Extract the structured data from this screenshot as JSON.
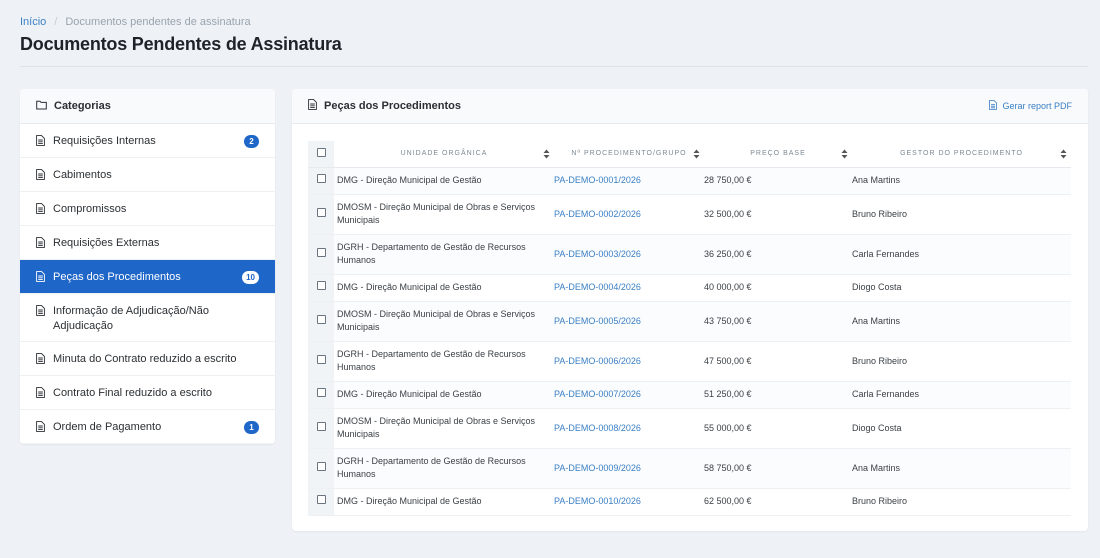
{
  "breadcrumb": {
    "home": "Início",
    "current": "Documentos pendentes de assinatura"
  },
  "page_title": "Documentos Pendentes de Assinatura",
  "sidebar": {
    "title": "Categorias",
    "items": [
      {
        "label": "Requisições Internas",
        "badge": "2"
      },
      {
        "label": "Cabimentos",
        "badge": ""
      },
      {
        "label": "Compromissos",
        "badge": ""
      },
      {
        "label": "Requisições Externas",
        "badge": ""
      },
      {
        "label": "Peças dos Procedimentos",
        "badge": "10",
        "active": true
      },
      {
        "label": "Informação de Adjudicação/Não Adjudicação",
        "badge": ""
      },
      {
        "label": "Minuta do Contrato reduzido a escrito",
        "badge": ""
      },
      {
        "label": "Contrato Final reduzido a escrito",
        "badge": ""
      },
      {
        "label": "Ordem de Pagamento",
        "badge": "1"
      }
    ]
  },
  "panel": {
    "title": "Peças dos Procedimentos",
    "report_link": "Gerar report PDF"
  },
  "table": {
    "headers": [
      "Unidade Orgânica",
      "Nº Procedimento/Grupo",
      "Preço Base",
      "Gestor do Procedimento"
    ],
    "rows": [
      {
        "unit": "DMG - Direção Municipal de Gestão",
        "proc": "PA-DEMO-0001/2026",
        "price": "28 750,00 €",
        "gestor": "Ana Martins"
      },
      {
        "unit": "DMOSM - Direção Municipal de Obras e Serviços Municipais",
        "proc": "PA-DEMO-0002/2026",
        "price": "32 500,00 €",
        "gestor": "Bruno Ribeiro"
      },
      {
        "unit": "DGRH - Departamento de Gestão de Recursos Humanos",
        "proc": "PA-DEMO-0003/2026",
        "price": "36 250,00 €",
        "gestor": "Carla Fernandes"
      },
      {
        "unit": "DMG - Direção Municipal de Gestão",
        "proc": "PA-DEMO-0004/2026",
        "price": "40 000,00 €",
        "gestor": "Diogo Costa"
      },
      {
        "unit": "DMOSM - Direção Municipal de Obras e Serviços Municipais",
        "proc": "PA-DEMO-0005/2026",
        "price": "43 750,00 €",
        "gestor": "Ana Martins"
      },
      {
        "unit": "DGRH - Departamento de Gestão de Recursos Humanos",
        "proc": "PA-DEMO-0006/2026",
        "price": "47 500,00 €",
        "gestor": "Bruno Ribeiro"
      },
      {
        "unit": "DMG - Direção Municipal de Gestão",
        "proc": "PA-DEMO-0007/2026",
        "price": "51 250,00 €",
        "gestor": "Carla Fernandes"
      },
      {
        "unit": "DMOSM - Direção Municipal de Obras e Serviços Municipais",
        "proc": "PA-DEMO-0008/2026",
        "price": "55 000,00 €",
        "gestor": "Diogo Costa"
      },
      {
        "unit": "DGRH - Departamento de Gestão de Recursos Humanos",
        "proc": "PA-DEMO-0009/2026",
        "price": "58 750,00 €",
        "gestor": "Ana Martins"
      },
      {
        "unit": "DMG - Direção Municipal de Gestão",
        "proc": "PA-DEMO-0010/2026",
        "price": "62 500,00 €",
        "gestor": "Bruno Ribeiro"
      }
    ]
  },
  "colors": {
    "accent": "#1e66c8",
    "link": "#3a7fc4",
    "background": "#eef2f7"
  },
  "icons": {
    "category": "folder-icon",
    "item": "document-icon",
    "sort": "sort-icon",
    "report": "document-icon"
  }
}
